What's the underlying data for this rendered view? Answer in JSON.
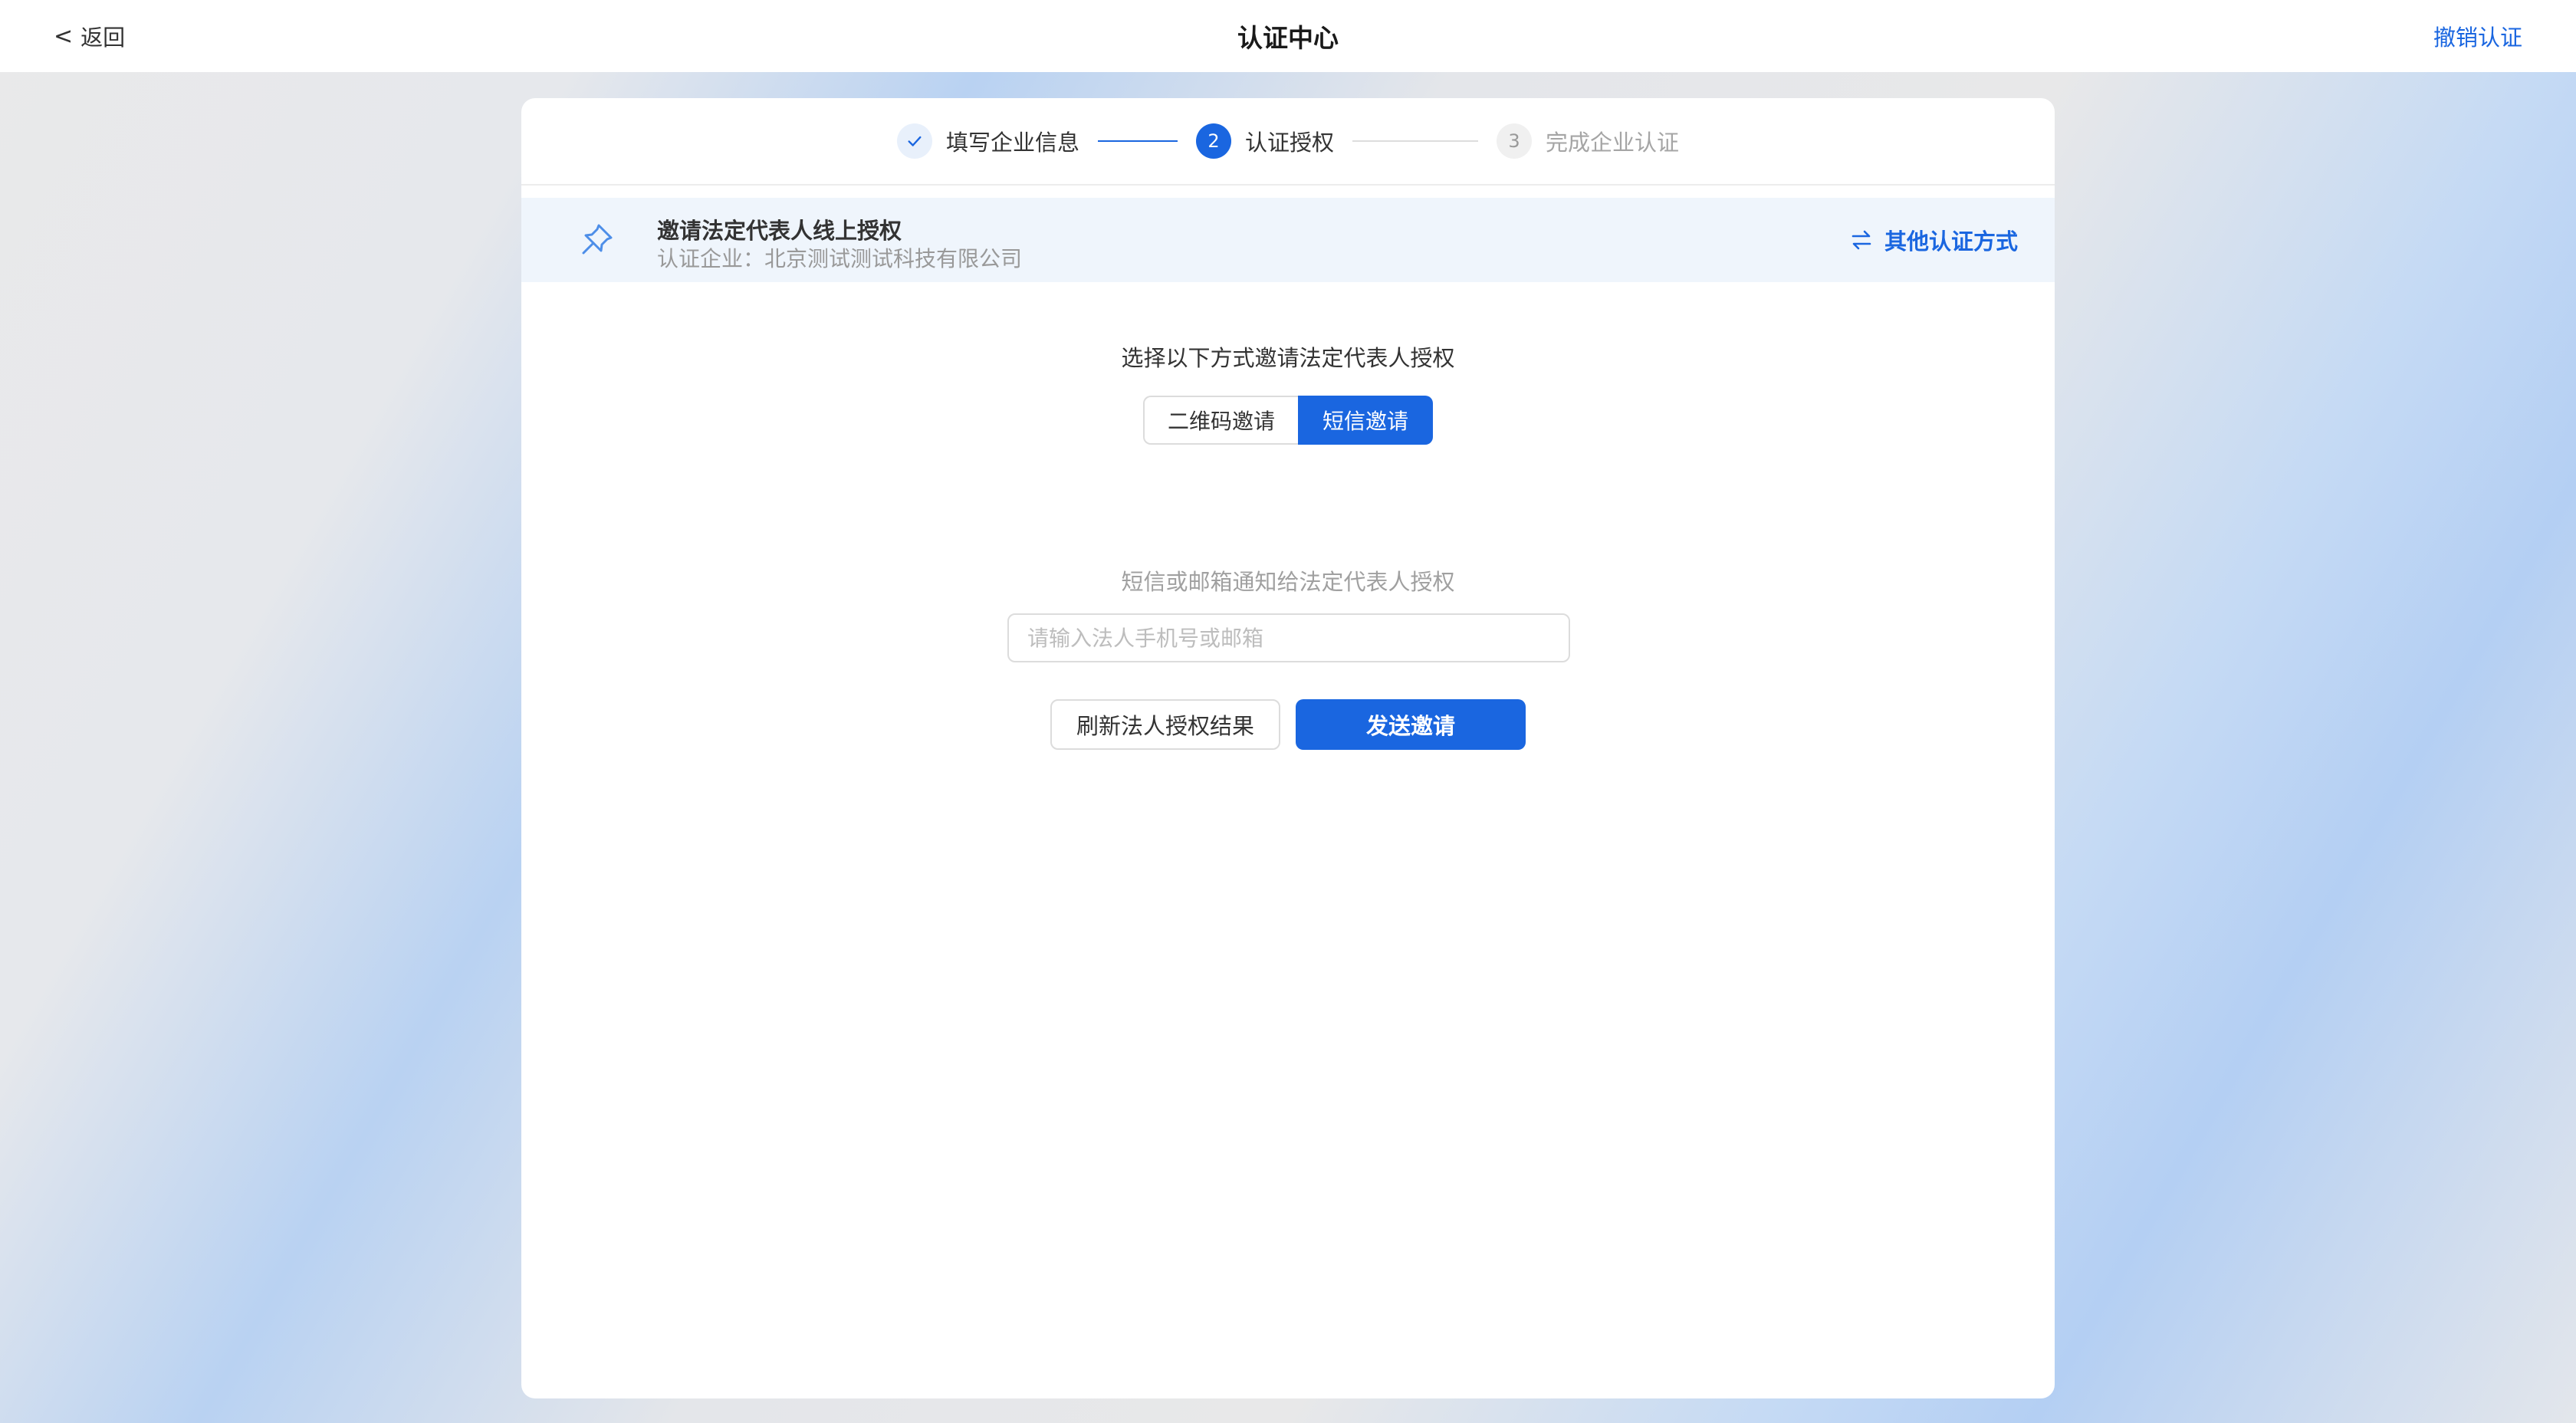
{
  "header": {
    "back_label": "返回",
    "title": "认证中心",
    "revoke_label": "撤销认证"
  },
  "steps": [
    {
      "number": "1",
      "label": "填写企业信息",
      "status": "done"
    },
    {
      "number": "2",
      "label": "认证授权",
      "status": "active"
    },
    {
      "number": "3",
      "label": "完成企业认证",
      "status": "pending"
    }
  ],
  "banner": {
    "title": "邀请法定代表人线上授权",
    "subtitle": "认证企业：北京测试测试科技有限公司",
    "other_methods_label": "其他认证方式"
  },
  "main": {
    "instruction": "选择以下方式邀请法定代表人授权",
    "toggle_options": [
      {
        "label": "二维码邀请",
        "selected": false
      },
      {
        "label": "短信邀请",
        "selected": true
      }
    ],
    "hint": "短信或邮箱通知给法定代表人授权",
    "input_value": "",
    "input_placeholder": "请输入法人手机号或邮箱",
    "refresh_label": "刷新法人授权结果",
    "send_label": "发送邀请"
  },
  "colors": {
    "accent": "#1a66e0",
    "banner_bg": "#eff5fc"
  },
  "icons": {
    "back": "chevron-left-icon",
    "step_done": "check-icon",
    "banner": "pin-icon",
    "other_methods": "swap-icon"
  }
}
